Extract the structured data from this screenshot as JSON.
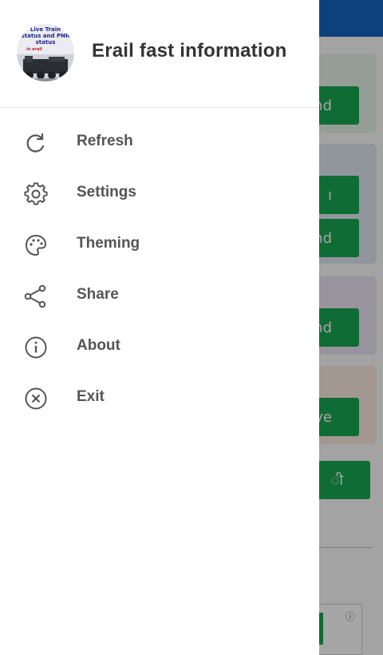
{
  "drawer": {
    "app_name": "Erail fast information",
    "logo": {
      "line1": "Live Train",
      "line2": "status and PNR",
      "line3": "status",
      "line4": "in erail"
    },
    "menu": [
      {
        "label": "Refresh",
        "icon": "refresh-icon"
      },
      {
        "label": "Settings",
        "icon": "gear-icon"
      },
      {
        "label": "Theming",
        "icon": "palette-icon"
      },
      {
        "label": "Share",
        "icon": "share-icon"
      },
      {
        "label": "About",
        "icon": "info-icon"
      },
      {
        "label": "Exit",
        "icon": "close-circle-icon"
      }
    ]
  },
  "background": {
    "buttons": [
      "nd",
      "ı",
      "nd",
      "nd",
      "ve",
      "ी"
    ]
  },
  "colors": {
    "topbar": "#1565c0",
    "button": "#18a650",
    "scrim": "rgba(0,0,0,0.35)"
  }
}
